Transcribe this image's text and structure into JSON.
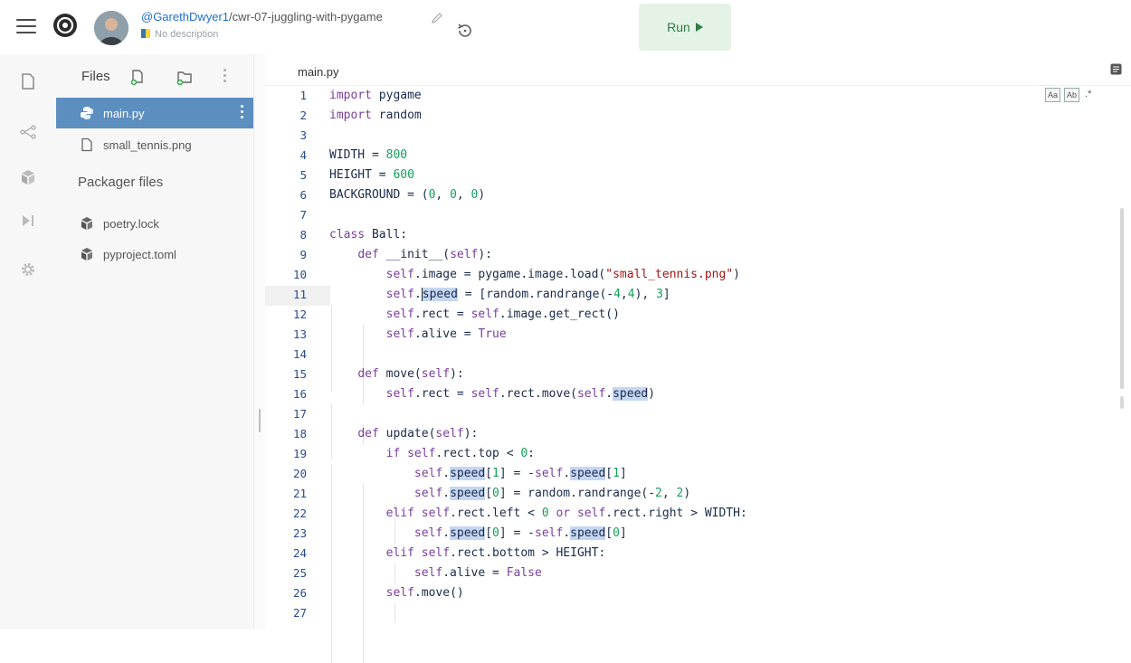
{
  "topbar": {
    "user": "@GarethDwyer1",
    "repl_slug": "/cwr-07-juggling-with-pygame",
    "description": "No description",
    "run_label": "Run"
  },
  "files": {
    "header": "Files",
    "items": [
      {
        "name": "main.py",
        "icon": "python-icon",
        "active": true
      },
      {
        "name": "small_tennis.png",
        "icon": "file-icon",
        "active": false
      }
    ],
    "packager_header": "Packager files",
    "packager_items": [
      {
        "name": "poetry.lock",
        "icon": "package-icon"
      },
      {
        "name": "pyproject.toml",
        "icon": "package-icon"
      }
    ]
  },
  "editor": {
    "tab": "main.py",
    "find_tools": [
      "Aa",
      "Ab",
      ".*"
    ],
    "line_numbers": [
      "1",
      "2",
      "3",
      "4",
      "5",
      "6",
      "7",
      "8",
      "9",
      "10",
      "11",
      "12",
      "13",
      "14",
      "15",
      "16",
      "17",
      "18",
      "19",
      "20",
      "21",
      "22",
      "23",
      "24",
      "25",
      "26",
      "27"
    ],
    "current_line": 11,
    "code": [
      "import pygame",
      "import random",
      "",
      "WIDTH = 800",
      "HEIGHT = 600",
      "BACKGROUND = (0, 0, 0)",
      "",
      "class Ball:",
      "    def __init__(self):",
      "        self.image = pygame.image.load(\"small_tennis.png\")",
      "        self.speed = [random.randrange(-4,4), 3]",
      "        self.rect = self.image.get_rect()",
      "        self.alive = True",
      "",
      "    def move(self):",
      "        self.rect = self.rect.move(self.speed)",
      "",
      "    def update(self):",
      "        if self.rect.top < 0:",
      "            self.speed[1] = -self.speed[1]",
      "            self.speed[0] = random.randrange(-2, 2)",
      "        elif self.rect.left < 0 or self.rect.right > WIDTH:",
      "            self.speed[0] = -self.speed[0]",
      "        elif self.rect.bottom > HEIGHT:",
      "            self.alive = False",
      "        self.move()",
      ""
    ]
  }
}
